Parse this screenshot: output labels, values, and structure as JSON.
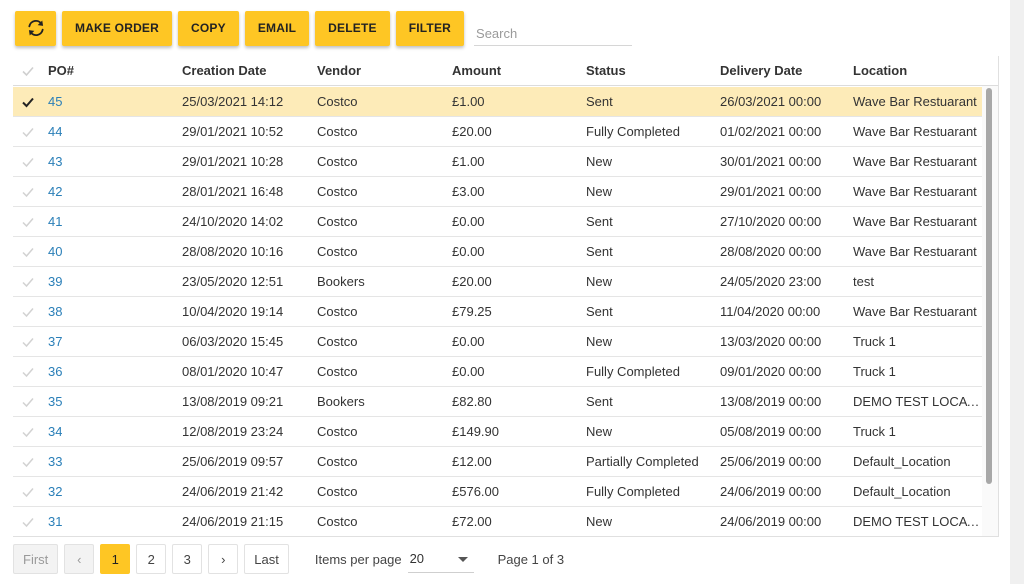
{
  "toolbar": {
    "refresh_icon": "refresh-icon",
    "make_order_label": "MAKE ORDER",
    "copy_label": "COPY",
    "email_label": "EMAIL",
    "delete_label": "DELETE",
    "filter_label": "FILTER",
    "accent_color": "#fec624"
  },
  "search": {
    "placeholder": "Search",
    "value": ""
  },
  "table": {
    "columns": {
      "po": "PO#",
      "creation_date": "Creation Date",
      "vendor": "Vendor",
      "amount": "Amount",
      "status": "Status",
      "delivery_date": "Delivery Date",
      "location": "Location"
    },
    "rows": [
      {
        "selected": true,
        "po": "45",
        "creation_date": "25/03/2021 14:12",
        "vendor": "Costco",
        "amount": "£1.00",
        "status": "Sent",
        "delivery_date": "26/03/2021 00:00",
        "location": "Wave Bar Restuarant"
      },
      {
        "selected": false,
        "po": "44",
        "creation_date": "29/01/2021 10:52",
        "vendor": "Costco",
        "amount": "£20.00",
        "status": "Fully Completed",
        "delivery_date": "01/02/2021 00:00",
        "location": "Wave Bar Restuarant"
      },
      {
        "selected": false,
        "po": "43",
        "creation_date": "29/01/2021 10:28",
        "vendor": "Costco",
        "amount": "£1.00",
        "status": "New",
        "delivery_date": "30/01/2021 00:00",
        "location": "Wave Bar Restuarant"
      },
      {
        "selected": false,
        "po": "42",
        "creation_date": "28/01/2021 16:48",
        "vendor": "Costco",
        "amount": "£3.00",
        "status": "New",
        "delivery_date": "29/01/2021 00:00",
        "location": "Wave Bar Restuarant"
      },
      {
        "selected": false,
        "po": "41",
        "creation_date": "24/10/2020 14:02",
        "vendor": "Costco",
        "amount": "£0.00",
        "status": "Sent",
        "delivery_date": "27/10/2020 00:00",
        "location": "Wave Bar Restuarant"
      },
      {
        "selected": false,
        "po": "40",
        "creation_date": "28/08/2020 10:16",
        "vendor": "Costco",
        "amount": "£0.00",
        "status": "Sent",
        "delivery_date": "28/08/2020 00:00",
        "location": "Wave Bar Restuarant"
      },
      {
        "selected": false,
        "po": "39",
        "creation_date": "23/05/2020 12:51",
        "vendor": "Bookers",
        "amount": "£20.00",
        "status": "New",
        "delivery_date": "24/05/2020 23:00",
        "location": "test"
      },
      {
        "selected": false,
        "po": "38",
        "creation_date": "10/04/2020 19:14",
        "vendor": "Costco",
        "amount": "£79.25",
        "status": "Sent",
        "delivery_date": "11/04/2020 00:00",
        "location": "Wave Bar Restuarant"
      },
      {
        "selected": false,
        "po": "37",
        "creation_date": "06/03/2020 15:45",
        "vendor": "Costco",
        "amount": "£0.00",
        "status": "New",
        "delivery_date": "13/03/2020 00:00",
        "location": "Truck 1"
      },
      {
        "selected": false,
        "po": "36",
        "creation_date": "08/01/2020 10:47",
        "vendor": "Costco",
        "amount": "£0.00",
        "status": "Fully Completed",
        "delivery_date": "09/01/2020 00:00",
        "location": "Truck 1"
      },
      {
        "selected": false,
        "po": "35",
        "creation_date": "13/08/2019 09:21",
        "vendor": "Bookers",
        "amount": "£82.80",
        "status": "Sent",
        "delivery_date": "13/08/2019 00:00",
        "location": "DEMO TEST LOCAT..."
      },
      {
        "selected": false,
        "po": "34",
        "creation_date": "12/08/2019 23:24",
        "vendor": "Costco",
        "amount": "£149.90",
        "status": "New",
        "delivery_date": "05/08/2019 00:00",
        "location": "Truck 1"
      },
      {
        "selected": false,
        "po": "33",
        "creation_date": "25/06/2019 09:57",
        "vendor": "Costco",
        "amount": "£12.00",
        "status": "Partially Completed",
        "delivery_date": "25/06/2019 00:00",
        "location": "Default_Location"
      },
      {
        "selected": false,
        "po": "32",
        "creation_date": "24/06/2019 21:42",
        "vendor": "Costco",
        "amount": "£576.00",
        "status": "Fully Completed",
        "delivery_date": "24/06/2019 00:00",
        "location": "Default_Location"
      },
      {
        "selected": false,
        "po": "31",
        "creation_date": "24/06/2019 21:15",
        "vendor": "Costco",
        "amount": "£72.00",
        "status": "New",
        "delivery_date": "24/06/2019 00:00",
        "location": "DEMO TEST LOCAT..."
      }
    ],
    "selected_row_color": "#fdebb8",
    "po_link_color": "#2a7fb8"
  },
  "pager": {
    "first_label": "First",
    "prev_label": "‹",
    "pages": [
      "1",
      "2",
      "3"
    ],
    "active_page": "1",
    "next_label": "›",
    "last_label": "Last",
    "items_per_page_label": "Items per page",
    "items_per_page_value": "20",
    "page_info": "Page 1 of 3"
  }
}
